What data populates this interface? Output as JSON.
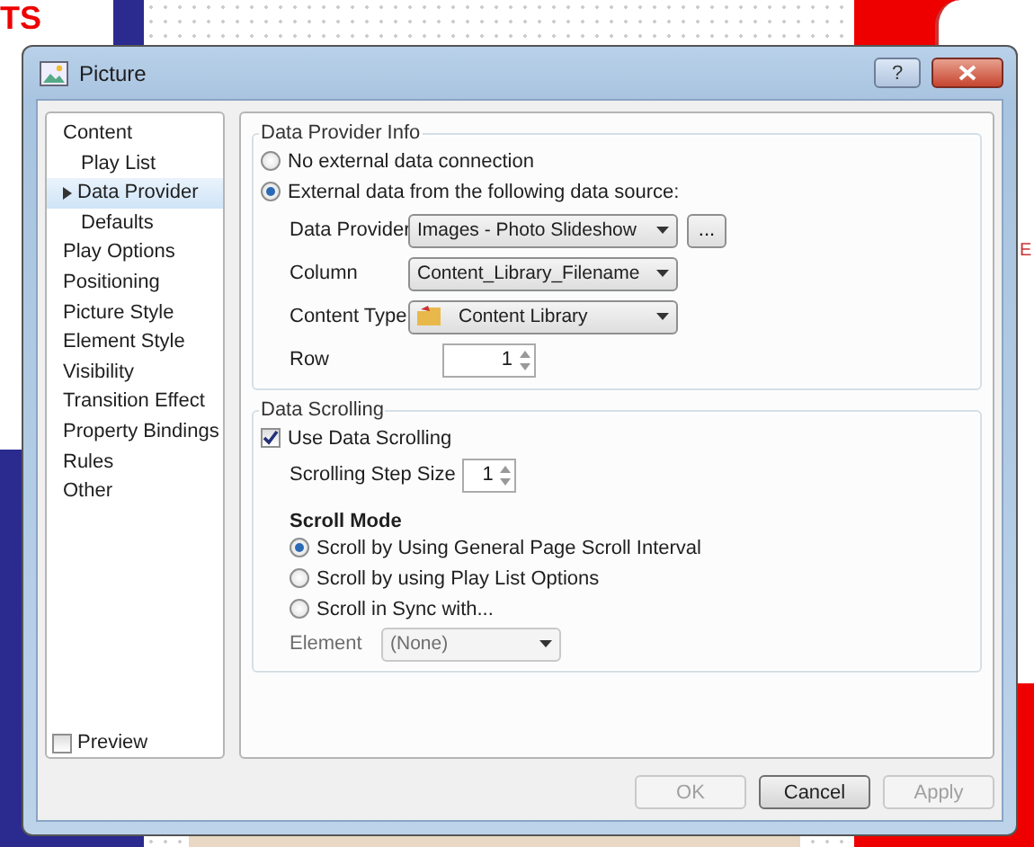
{
  "background": {
    "texts": [
      {
        "kind": "logo",
        "text": "TS"
      },
      {
        "kind": "side",
        "text": "E"
      }
    ]
  },
  "window": {
    "title": "Picture",
    "help_button": "?"
  },
  "sidebar": {
    "items": [
      {
        "label": "Content",
        "selected": false,
        "children": [
          {
            "label": "Play List",
            "selected": false
          },
          {
            "label": "Data Provider",
            "selected": true
          },
          {
            "label": "Defaults",
            "selected": false
          }
        ]
      },
      {
        "label": "Play Options",
        "selected": false
      },
      {
        "label": "Positioning",
        "selected": false
      },
      {
        "label": "Picture Style",
        "selected": false
      },
      {
        "label": "Element Style",
        "selected": false
      },
      {
        "label": "Visibility",
        "selected": false
      },
      {
        "label": "Transition Effect",
        "selected": false
      },
      {
        "label": "Property Bindings",
        "selected": false
      },
      {
        "label": "Rules",
        "selected": false
      },
      {
        "label": "Other",
        "selected": false
      }
    ],
    "preview": {
      "label": "Preview",
      "checked": false
    }
  },
  "data_provider_info": {
    "title": "Data Provider Info",
    "options": [
      {
        "label": "No external data connection",
        "selected": false
      },
      {
        "label": "External data from the following data source:",
        "selected": true
      }
    ],
    "fields": [
      {
        "kind": "dropdown",
        "label": "Data Provider",
        "value": "Images - Photo Slideshow",
        "button": "..."
      },
      {
        "kind": "dropdown",
        "label": "Column",
        "value": "Content_Library_Filename"
      },
      {
        "kind": "dropdown",
        "label": "Content Type",
        "value": "Content Library",
        "icon": true
      },
      {
        "kind": "spinner",
        "label": "Row",
        "value": "1"
      }
    ]
  },
  "data_scrolling": {
    "title": "Data Scrolling",
    "use_data_scrolling": {
      "label": "Use Data Scrolling",
      "checked": true
    },
    "step_size": {
      "label": "Scrolling Step Size",
      "value": "1"
    },
    "scroll_mode": {
      "title": "Scroll Mode",
      "options": [
        {
          "label": "Scroll by Using General Page Scroll Interval",
          "selected": true
        },
        {
          "label": "Scroll by using Play List Options",
          "selected": false
        },
        {
          "label": "Scroll in Sync with...",
          "selected": false
        }
      ],
      "element": {
        "label": "Element",
        "value": "(None)",
        "disabled": true
      }
    }
  },
  "buttons": [
    {
      "label": "OK",
      "disabled": true
    },
    {
      "label": "Cancel",
      "disabled": false
    },
    {
      "label": "Apply",
      "disabled": true
    }
  ]
}
